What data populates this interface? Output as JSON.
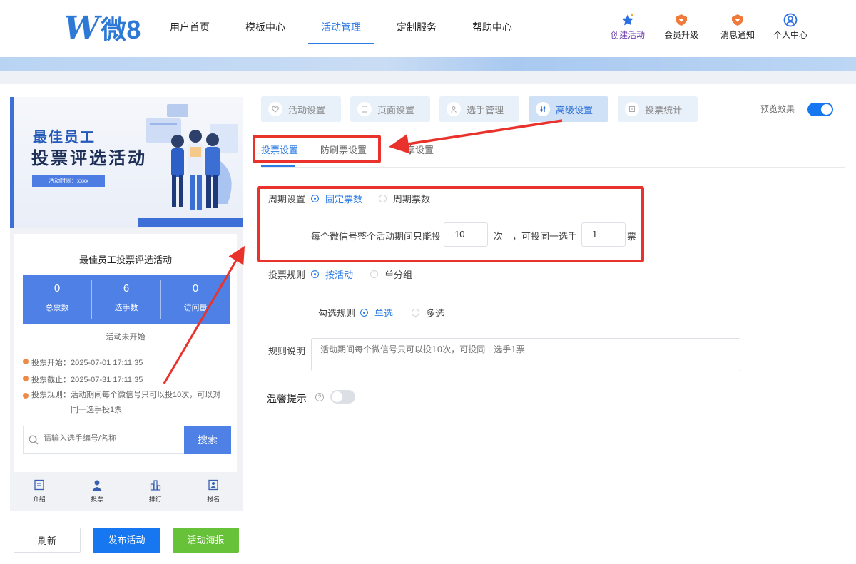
{
  "header": {
    "logo_mark": "W",
    "logo_text": "微8",
    "nav": [
      {
        "label": "用户首页"
      },
      {
        "label": "模板中心"
      },
      {
        "label": "活动管理"
      },
      {
        "label": "定制服务"
      },
      {
        "label": "帮助中心"
      }
    ],
    "right_nav": [
      {
        "label": "创建活动",
        "icon": "star-icon"
      },
      {
        "label": "会员升级",
        "icon": "vip-badge-icon"
      },
      {
        "label": "消息通知",
        "icon": "bell-badge-icon"
      },
      {
        "label": "个人中心",
        "icon": "user-circle-icon"
      }
    ]
  },
  "phone": {
    "banner": {
      "line1": "最佳员工",
      "line2": "投票评选活动",
      "time_tag": "活动时间：xxxx"
    },
    "card": {
      "title": "最佳员工投票评选活动",
      "stats": [
        {
          "value": "0",
          "label": "总票数"
        },
        {
          "value": "6",
          "label": "选手数"
        },
        {
          "value": "0",
          "label": "访问量"
        }
      ],
      "status": "活动未开始",
      "start": "投票开始：2025-07-01 17:11:35",
      "end": "投票截止：2025-07-31 17:11:35",
      "rule_line1": "投票规则：活动期间每个微信号只可以投10次，可以对",
      "rule_line2": "同一选手投1票",
      "search_placeholder": "请输入选手编号/名称",
      "search_button": "搜索"
    },
    "tabbar": [
      {
        "label": "介绍",
        "icon": "intro-icon"
      },
      {
        "label": "投票",
        "icon": "person-icon"
      },
      {
        "label": "排行",
        "icon": "ranking-icon"
      },
      {
        "label": "报名",
        "icon": "signup-icon"
      }
    ]
  },
  "buttons": {
    "refresh": "刷新",
    "publish": "发布活动",
    "poster": "活动海报"
  },
  "steps": [
    {
      "label": "活动设置",
      "icon": "heart-icon"
    },
    {
      "label": "页面设置",
      "icon": "page-icon"
    },
    {
      "label": "选手管理",
      "icon": "contestant-icon"
    },
    {
      "label": "高级设置",
      "icon": "advanced-icon"
    },
    {
      "label": "投票统计",
      "icon": "stats-icon"
    }
  ],
  "preview_label": "预览效果",
  "subtabs": {
    "vote_settings": "投票设置",
    "anti_fraud": "防刷票设置",
    "partial_hidden": "享设置"
  },
  "form": {
    "period_label": "周期设置",
    "period_options": [
      "固定票数",
      "周期票数"
    ],
    "per_wechat_text": "每个微信号整个活动期间只能投",
    "times_value": "10",
    "times_unit": "次",
    "same_contestant_text": "，可投同一选手",
    "same_value": "1",
    "same_unit": "票",
    "rule_label": "投票规则",
    "rule_options": [
      "按活动",
      "单分组"
    ],
    "select_rule_label": "勾选规则",
    "select_options": [
      "单选",
      "多选"
    ],
    "desc_label": "规则说明",
    "desc_placeholder": "活动期间每个微信号只可以投10次，可投同一选手1票",
    "tip_label": "温馨提示",
    "help_glyph": "?"
  },
  "colors": {
    "primary": "#2b7be6",
    "button_blue": "#1677f0",
    "button_green": "#67c23a",
    "annotation_red": "#e8322b"
  }
}
